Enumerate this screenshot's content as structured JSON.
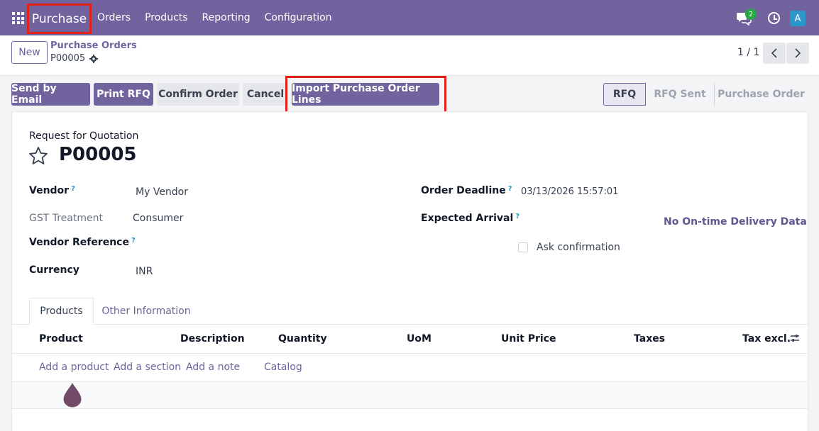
{
  "navbar": {
    "app_name": "Purchase",
    "menu": [
      "Orders",
      "Products",
      "Reporting",
      "Configuration"
    ],
    "chat_badge": "2",
    "avatar_letter": "A",
    "icons": [
      "apps-grid-icon",
      "chat-icon",
      "clock-icon"
    ]
  },
  "control_panel": {
    "new_label": "New",
    "breadcrumb_parent": "Purchase Orders",
    "breadcrumb_current": "P00005",
    "pager": "1 / 1"
  },
  "actions": {
    "send_by_email": "Send by Email",
    "print_rfq": "Print RFQ",
    "confirm_order": "Confirm Order",
    "cancel": "Cancel",
    "import_lines": "Import Purchase Order Lines"
  },
  "status": {
    "steps": [
      "RFQ",
      "RFQ Sent",
      "Purchase Order"
    ],
    "active": "RFQ"
  },
  "form": {
    "subtitle": "Request for Quotation",
    "reference": "P00005",
    "vendor_label": "Vendor",
    "vendor_value": "My Vendor",
    "gst_label": "GST Treatment",
    "gst_value": "Consumer",
    "vendor_ref_label": "Vendor Reference",
    "currency_label": "Currency",
    "currency_value": "INR",
    "deadline_label": "Order Deadline",
    "deadline_value": "03/13/2026 15:57:01",
    "arrival_label": "Expected Arrival",
    "ontime": "No On-time Delivery Data",
    "ask_confirmation": "Ask confirmation",
    "help_mark": "?"
  },
  "tabs": {
    "products": "Products",
    "other": "Other Information"
  },
  "table": {
    "columns": [
      "Product",
      "Description",
      "Quantity",
      "UoM",
      "Unit Price",
      "Taxes",
      "Tax excl."
    ],
    "add_product": "Add a product",
    "add_section": "Add a section",
    "add_note": "Add a note",
    "catalog": "Catalog"
  },
  "colors": {
    "brand": "#71639e",
    "highlight": "#e2231a",
    "badge": "#28a745",
    "avatar": "#2a96c9"
  }
}
